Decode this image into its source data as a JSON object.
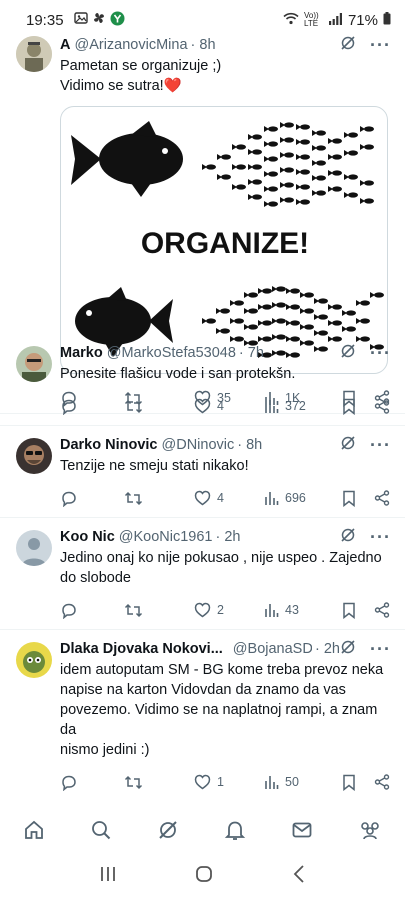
{
  "status_bar": {
    "time": "19:35",
    "network_label": "Vo)) LTE",
    "battery_percent": "71%",
    "icons": [
      "image-icon",
      "pinwheel-icon",
      "yandex-icon",
      "wifi-icon",
      "signal-icon",
      "battery-icon"
    ]
  },
  "tweets": [
    {
      "name": "A",
      "handle": "@ArizanovicMina",
      "time": "· 8h",
      "lines": [
        "Pametan se organizuje ;)",
        "Vidimo se sutra!❤️"
      ],
      "media_text": "ORGANIZE!",
      "stats": {
        "replies": "",
        "retweets": "",
        "likes": "35",
        "views": "1K"
      }
    },
    {
      "name": "Marko",
      "handle": "@MarkoStefa53048",
      "time": "· 7h",
      "lines": [
        "Ponesite flašicu vode i san protekšn."
      ],
      "stats": {
        "replies": "",
        "retweets": "",
        "likes": "4",
        "views": "372"
      }
    },
    {
      "name": "Darko Ninovic",
      "handle": "@DNinovic",
      "time": "· 8h",
      "lines": [
        "Tenzije ne smeju stati nikako!"
      ],
      "stats": {
        "replies": "",
        "retweets": "",
        "likes": "4",
        "views": "696"
      }
    },
    {
      "name": "Koo Nic",
      "handle": "@KooNic1961",
      "time": "· 2h",
      "lines": [
        "Jedino onaj ko nije pokusao , nije uspeo . Zajedno",
        "do slobode"
      ],
      "stats": {
        "replies": "",
        "retweets": "",
        "likes": "2",
        "views": "43"
      }
    },
    {
      "name": "Dlaka Djovaka Nokovi...",
      "handle": "@BojanaSD...",
      "time": "· 2h",
      "lines": [
        "idem autoputam SM - BG kome treba prevoz neka",
        "napise na karton Vidovdan da znamo da vas",
        "povezemo. Vidimo se na naplatnoj rampi, a znam da",
        "nismo jedini :)"
      ],
      "stats": {
        "replies": "",
        "retweets": "",
        "likes": "1",
        "views": "50"
      }
    }
  ],
  "bottom_nav": [
    "home-icon",
    "search-icon",
    "grok-icon",
    "notifications-icon",
    "messages-icon",
    "communities-icon"
  ],
  "android_nav": [
    "recents-icon",
    "home-button-icon",
    "back-icon"
  ],
  "colors": {
    "text": "#0f1419",
    "muted": "#536471",
    "divider": "#eff3f4",
    "heart": "#e0245e"
  }
}
